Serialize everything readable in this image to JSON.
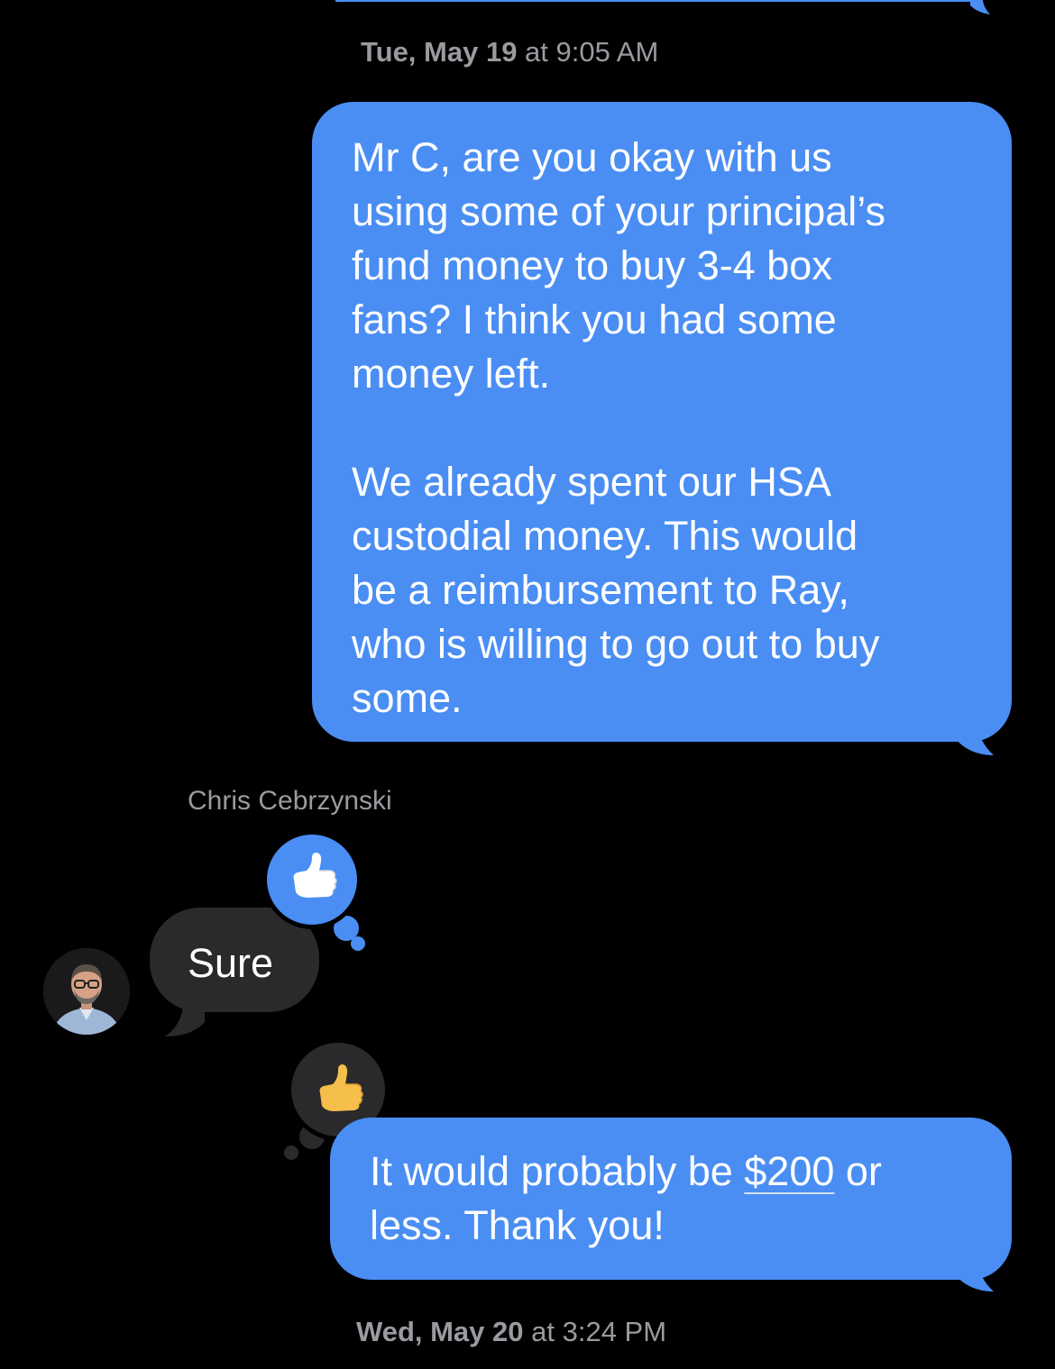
{
  "conversation": {
    "timestamps": [
      {
        "day": "Tue, May 19",
        "sep": " at ",
        "time": "9:05 AM"
      },
      {
        "day": "Wed, May 20",
        "sep": " at ",
        "time": "3:24 PM"
      }
    ],
    "messages": {
      "outgoing_1": {
        "para_1_lines": [
          "Mr C, are you okay with us",
          "using some of your principal’s",
          "fund money to buy 3-4 box",
          "fans?  I think you had some",
          "money left."
        ],
        "para_2_lines": [
          "We already spent our HSA",
          "custodial money.  This would",
          "be a reimbursement to Ray,",
          "who is willing to go out to buy",
          "some."
        ]
      },
      "incoming_1": {
        "sender": "Chris Cebrzynski",
        "text": "Sure"
      },
      "outgoing_2": {
        "line_1_pre": "It would probably be ",
        "line_1_link": "$200",
        "line_1_post": " or",
        "line_2": "less.  Thank you!"
      }
    },
    "tapbacks": {
      "on_incoming": "thumbs-up-icon",
      "on_outgoing_2": "thumbs-up-icon"
    },
    "colors": {
      "outgoing_bubble": "#4a8ef4",
      "incoming_bubble": "#2a2a2c",
      "background": "#000000",
      "meta_text": "#9a9aa0"
    }
  }
}
